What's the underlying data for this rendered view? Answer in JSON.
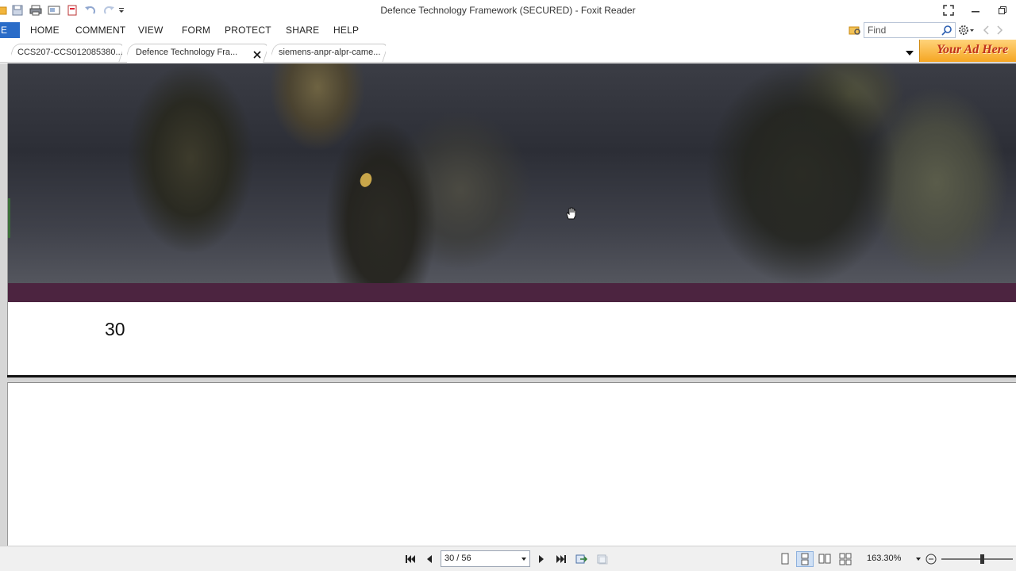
{
  "window": {
    "title": "Defence Technology Framework (SECURED) - Foxit Reader"
  },
  "menu": {
    "file": "E",
    "items": [
      "HOME",
      "COMMENT",
      "VIEW",
      "FORM",
      "PROTECT",
      "SHARE",
      "HELP"
    ]
  },
  "search": {
    "placeholder": "Find"
  },
  "tabs": [
    {
      "label": "CCS207-CCS012085380...",
      "active": false
    },
    {
      "label": "Defence Technology Fra...",
      "active": true
    },
    {
      "label": "siemens-anpr-alpr-came...",
      "active": false
    }
  ],
  "ad": {
    "text": "Your Ad Here"
  },
  "document": {
    "page_number_text": "30",
    "band_color": "#4c2440"
  },
  "statusbar": {
    "page_indicator": "30 / 56",
    "zoom": "163.30%"
  },
  "colors": {
    "accent": "#2a6cc8"
  }
}
